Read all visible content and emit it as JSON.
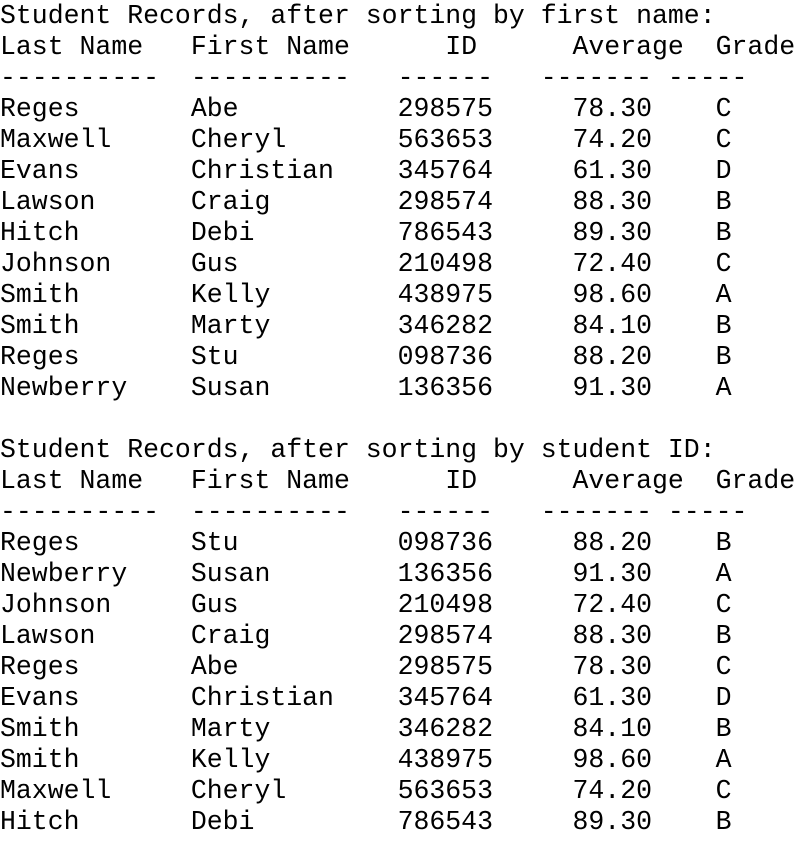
{
  "sections": [
    {
      "title": "Student Records, after sorting by first name:",
      "header": [
        "Last Name",
        "First Name",
        "ID",
        "Average",
        "Grade"
      ],
      "rule": [
        "----------",
        "----------",
        "------",
        "-------",
        "-----"
      ],
      "rows": [
        [
          "Reges",
          "Abe",
          "298575",
          "78.30",
          "C"
        ],
        [
          "Maxwell",
          "Cheryl",
          "563653",
          "74.20",
          "C"
        ],
        [
          "Evans",
          "Christian",
          "345764",
          "61.30",
          "D"
        ],
        [
          "Lawson",
          "Craig",
          "298574",
          "88.30",
          "B"
        ],
        [
          "Hitch",
          "Debi",
          "786543",
          "89.30",
          "B"
        ],
        [
          "Johnson",
          "Gus",
          "210498",
          "72.40",
          "C"
        ],
        [
          "Smith",
          "Kelly",
          "438975",
          "98.60",
          "A"
        ],
        [
          "Smith",
          "Marty",
          "346282",
          "84.10",
          "B"
        ],
        [
          "Reges",
          "Stu",
          "098736",
          "88.20",
          "B"
        ],
        [
          "Newberry",
          "Susan",
          "136356",
          "91.30",
          "A"
        ]
      ]
    },
    {
      "title": "Student Records, after sorting by student ID:",
      "header": [
        "Last Name",
        "First Name",
        "ID",
        "Average",
        "Grade"
      ],
      "rule": [
        "----------",
        "----------",
        "------",
        "-------",
        "-----"
      ],
      "rows": [
        [
          "Reges",
          "Stu",
          "098736",
          "88.20",
          "B"
        ],
        [
          "Newberry",
          "Susan",
          "136356",
          "91.30",
          "A"
        ],
        [
          "Johnson",
          "Gus",
          "210498",
          "72.40",
          "C"
        ],
        [
          "Lawson",
          "Craig",
          "298574",
          "88.30",
          "B"
        ],
        [
          "Reges",
          "Abe",
          "298575",
          "78.30",
          "C"
        ],
        [
          "Evans",
          "Christian",
          "345764",
          "61.30",
          "D"
        ],
        [
          "Smith",
          "Marty",
          "346282",
          "84.10",
          "B"
        ],
        [
          "Smith",
          "Kelly",
          "438975",
          "98.60",
          "A"
        ],
        [
          "Maxwell",
          "Cheryl",
          "563653",
          "74.20",
          "C"
        ],
        [
          "Hitch",
          "Debi",
          "786543",
          "89.30",
          "B"
        ]
      ]
    }
  ]
}
